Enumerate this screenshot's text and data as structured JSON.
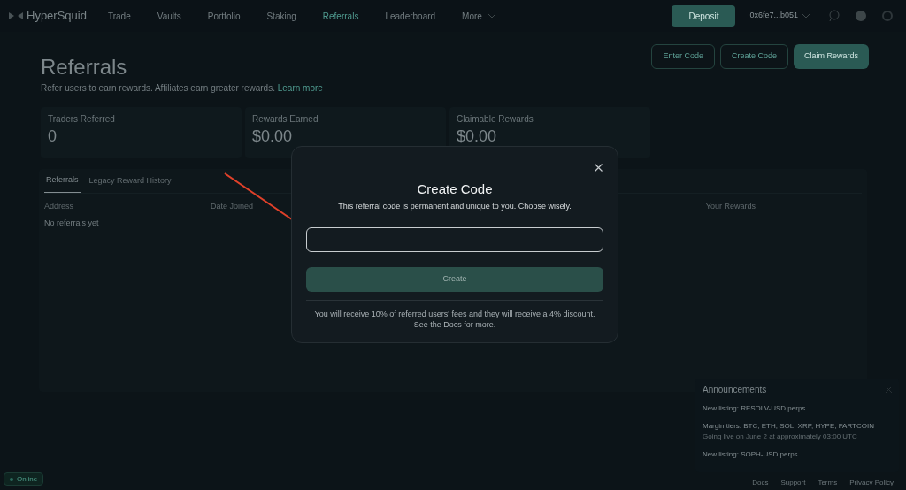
{
  "nav": {
    "logo": "HyperSquid",
    "items": [
      {
        "label": "Trade",
        "selected": false
      },
      {
        "label": "Vaults",
        "selected": false
      },
      {
        "label": "Portfolio",
        "selected": false
      },
      {
        "label": "Staking",
        "selected": false
      },
      {
        "label": "Referrals",
        "selected": true
      },
      {
        "label": "Leaderboard",
        "selected": false
      },
      {
        "label": "More",
        "selected": false
      }
    ],
    "deposit": "Deposit",
    "wallet": "0x6fe7...b051"
  },
  "page": {
    "title": "Referrals",
    "subtitle": "Refer users to earn rewards. Affiliates earn greater rewards.",
    "link": "Learn more",
    "buttons": [
      {
        "label": "Enter Code",
        "kind": "outline"
      },
      {
        "label": "Create Code",
        "kind": "outline"
      },
      {
        "label": "Claim Rewards",
        "kind": "filled"
      }
    ]
  },
  "stats": [
    {
      "label": "Traders Referred",
      "value": "0"
    },
    {
      "label": "Rewards Earned",
      "value": "$0.00"
    },
    {
      "label": "Claimable Rewards",
      "value": "$0.00"
    }
  ],
  "tabs": [
    {
      "label": "Referrals",
      "selected": true
    },
    {
      "label": "Legacy Reward History",
      "selected": false
    }
  ],
  "table": {
    "columns": [
      "Address",
      "Date Joined",
      "Your Rewards"
    ],
    "empty": "No referrals yet"
  },
  "modal": {
    "title": "Create Code",
    "subtitle": "This referral code is permanent and unique to you. Choose wisely.",
    "button": "Create",
    "note": "You will receive 10% of referred users' fees and they will receive a 4% discount.",
    "note2": "See the Docs for more."
  },
  "announcements": {
    "title": "Announcements",
    "items": [
      {
        "text": "New listing: RESOLV-USD perps"
      },
      {
        "text": "Margin tiers: BTC, ETH, SOL, XRP, HYPE, FARTCOIN",
        "detail": "Going live on June 2 at approximately 03:00 UTC"
      },
      {
        "text": "New listing: SOPH-USD perps"
      }
    ]
  },
  "footer": {
    "status": "Online",
    "links": [
      "Docs",
      "Support",
      "Terms",
      "Privacy Policy"
    ]
  }
}
